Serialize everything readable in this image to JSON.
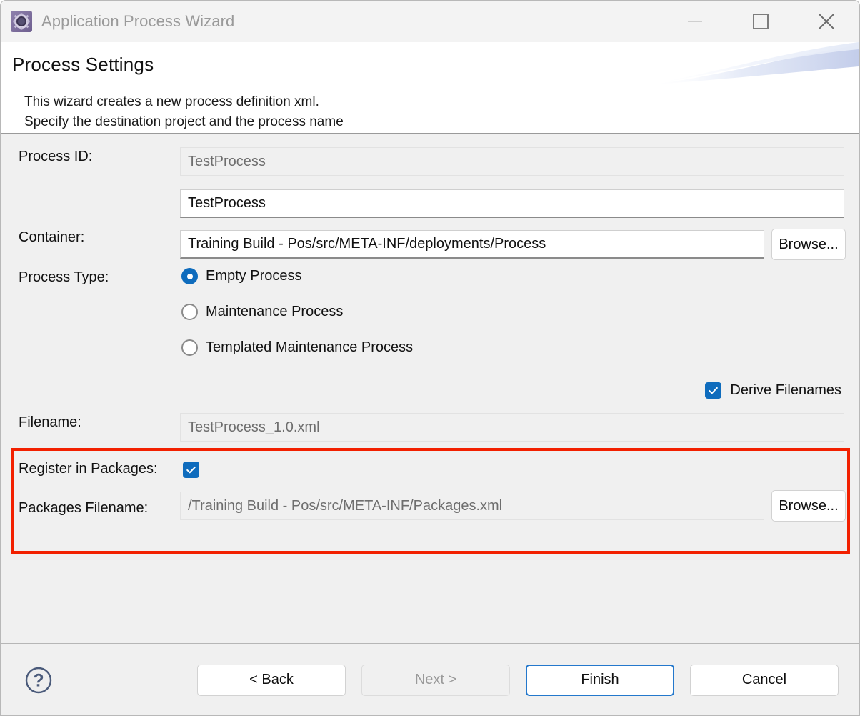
{
  "window": {
    "title": "Application Process Wizard",
    "app_icon": "gear-icon",
    "controls": {
      "minimize": "minimize-icon",
      "maximize": "maximize-icon",
      "close": "close-icon"
    }
  },
  "header": {
    "title": "Process Settings",
    "description_line1": "This wizard creates a new process definition xml.",
    "description_line2": "Specify the destination project and the process name"
  },
  "form": {
    "process_id": {
      "label": "Process ID:",
      "value": "TestProcess",
      "enabled": false
    },
    "process_name": {
      "label": "",
      "value": "TestProcess",
      "placeholder": "TestProcess",
      "enabled": true
    },
    "container": {
      "label": "Container:",
      "value": "Training Build - Pos/src/META-INF/deployments/Process",
      "browse_label": "Browse...",
      "enabled": true
    },
    "process_type": {
      "label": "Process Type:",
      "options": [
        {
          "label": "Empty Process",
          "selected": true
        },
        {
          "label": "Maintenance Process",
          "selected": false
        },
        {
          "label": "Templated Maintenance Process",
          "selected": false
        }
      ]
    },
    "derive_filenames": {
      "label": "Derive Filenames",
      "checked": true
    },
    "filename": {
      "label": "Filename:",
      "value": "TestProcess_1.0.xml",
      "enabled": false
    },
    "register_in_packages": {
      "label": "Register in Packages:",
      "checked": true
    },
    "packages_filename": {
      "label": "Packages Filename:",
      "value": "/Training Build - Pos/src/META-INF/Packages.xml",
      "browse_label": "Browse...",
      "enabled": false
    }
  },
  "footer": {
    "help_icon": "help-icon",
    "back_label": "< Back",
    "next_label": "Next >",
    "finish_label": "Finish",
    "cancel_label": "Cancel"
  },
  "annotation": {
    "highlight_color": "#f22000"
  },
  "colors": {
    "accent": "#0f6cbd",
    "focus_border": "#2478cc",
    "window_bg": "#f0f0f0",
    "header_bg": "#ffffff",
    "disabled_text": "#6e6e6e"
  }
}
